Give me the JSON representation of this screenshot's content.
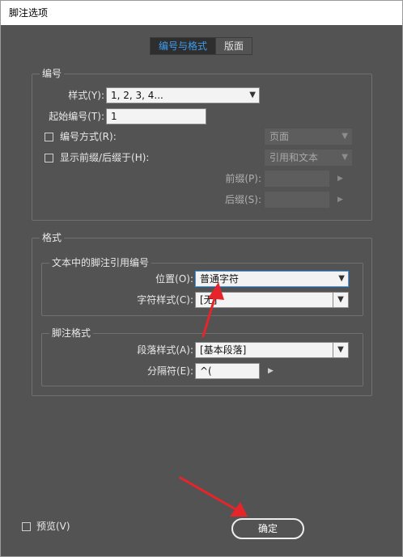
{
  "window": {
    "title": "脚注选项"
  },
  "tabs": [
    {
      "label": "编号与格式",
      "active": true
    },
    {
      "label": "版面",
      "active": false
    }
  ],
  "numbering": {
    "group_title": "编号",
    "style_label": "样式(Y):",
    "style_value": "1, 2, 3, 4...",
    "start_label": "起始编号(T):",
    "start_value": "1",
    "restart_label": "编号方式(R):",
    "restart_value": "页面",
    "prefix_suffix_label": "显示前缀/后缀于(H):",
    "prefix_suffix_value": "引用和文本",
    "prefix_label": "前缀(P):",
    "suffix_label": "后缀(S):"
  },
  "format": {
    "group_title": "格式",
    "ref_group_title": "文本中的脚注引用编号",
    "position_label": "位置(O):",
    "position_value": "普通字符",
    "char_style_label": "字符样式(C):",
    "char_style_value": "[无]",
    "fn_group_title": "脚注格式",
    "para_style_label": "段落样式(A):",
    "para_style_value": "[基本段落]",
    "separator_label": "分隔符(E):",
    "separator_value": "^("
  },
  "footer": {
    "preview_label": "预览(V)",
    "ok_label": "确定"
  },
  "colors": {
    "dialog_bg": "#535353",
    "accent_tab": "#3d9cf0",
    "annotation_arrow": "#e5252a"
  }
}
